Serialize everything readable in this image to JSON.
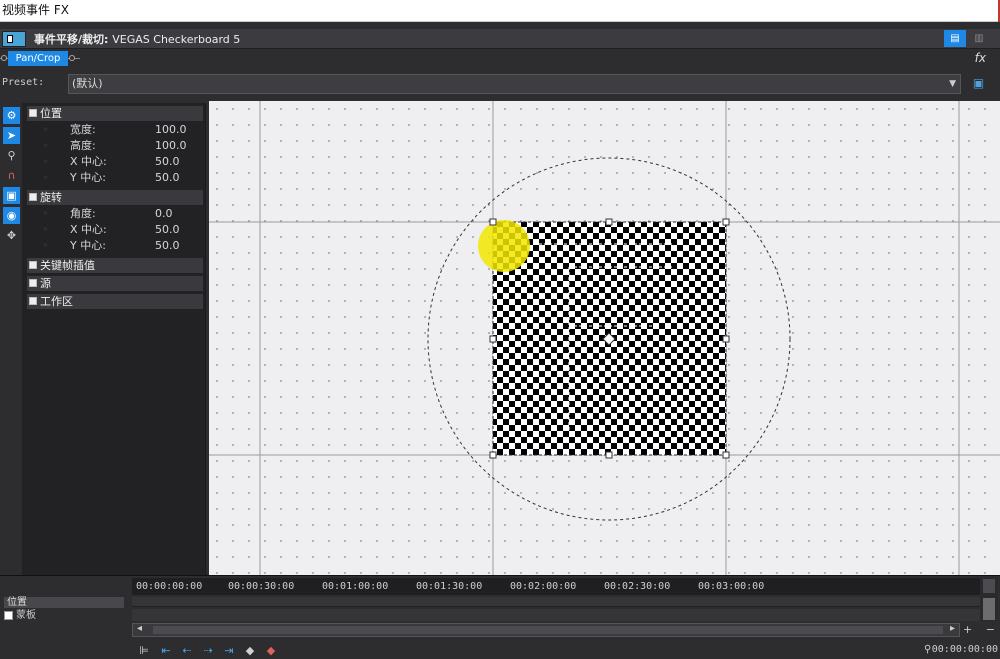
{
  "window": {
    "title": "视频事件 FX"
  },
  "header": {
    "label": "事件平移/裁切:",
    "clip_name": "VEGAS Checkerboard 5",
    "view_btn1": "▤",
    "view_btn2": "▥"
  },
  "fx_chain": {
    "tab_label": "Pan/Crop",
    "fx_icon": "fx-icon"
  },
  "preset": {
    "label": "Preset:",
    "value": "(默认)"
  },
  "tools": [
    {
      "name": "settings-icon",
      "glyph": "⚙",
      "active": true
    },
    {
      "name": "pointer-icon",
      "glyph": "➤",
      "active": true
    },
    {
      "name": "zoom-icon",
      "glyph": "⚲",
      "active": false
    },
    {
      "name": "magnet-icon",
      "glyph": "∩",
      "active": false
    },
    {
      "name": "lock-aspect-icon",
      "glyph": "▣",
      "active": true
    },
    {
      "name": "center-icon",
      "glyph": "◉",
      "active": true
    },
    {
      "name": "move-icon",
      "glyph": "✥",
      "active": false
    }
  ],
  "properties": {
    "position": {
      "title": "位置",
      "items": [
        {
          "key": "宽度:",
          "value": "100.0"
        },
        {
          "key": "高度:",
          "value": "100.0"
        },
        {
          "key": "X 中心:",
          "value": "50.0"
        },
        {
          "key": "Y 中心:",
          "value": "50.0"
        }
      ]
    },
    "rotation": {
      "title": "旋转",
      "items": [
        {
          "key": "角度:",
          "value": "0.0"
        },
        {
          "key": "X 中心:",
          "value": "50.0"
        },
        {
          "key": "Y 中心:",
          "value": "50.0"
        }
      ]
    },
    "keyframe_interp": {
      "title": "关键帧插值"
    },
    "source": {
      "title": "源"
    },
    "workspace": {
      "title": "工作区"
    }
  },
  "timeline": {
    "ticks": [
      "00:00:00:00",
      "00:00:30:00",
      "00:01:00:00",
      "00:01:30:00",
      "00:02:00:00",
      "00:02:30:00",
      "00:03:00:00"
    ],
    "track_name": "位置",
    "mask_label": "蒙板",
    "timecode": "00:00:00:00",
    "plus": "+",
    "minus": "−",
    "scroll_left": "◂",
    "scroll_right": "▸"
  },
  "colors": {
    "accent": "#1e88e5",
    "canvas_bg": "#efeff2",
    "panel": "#222225"
  }
}
